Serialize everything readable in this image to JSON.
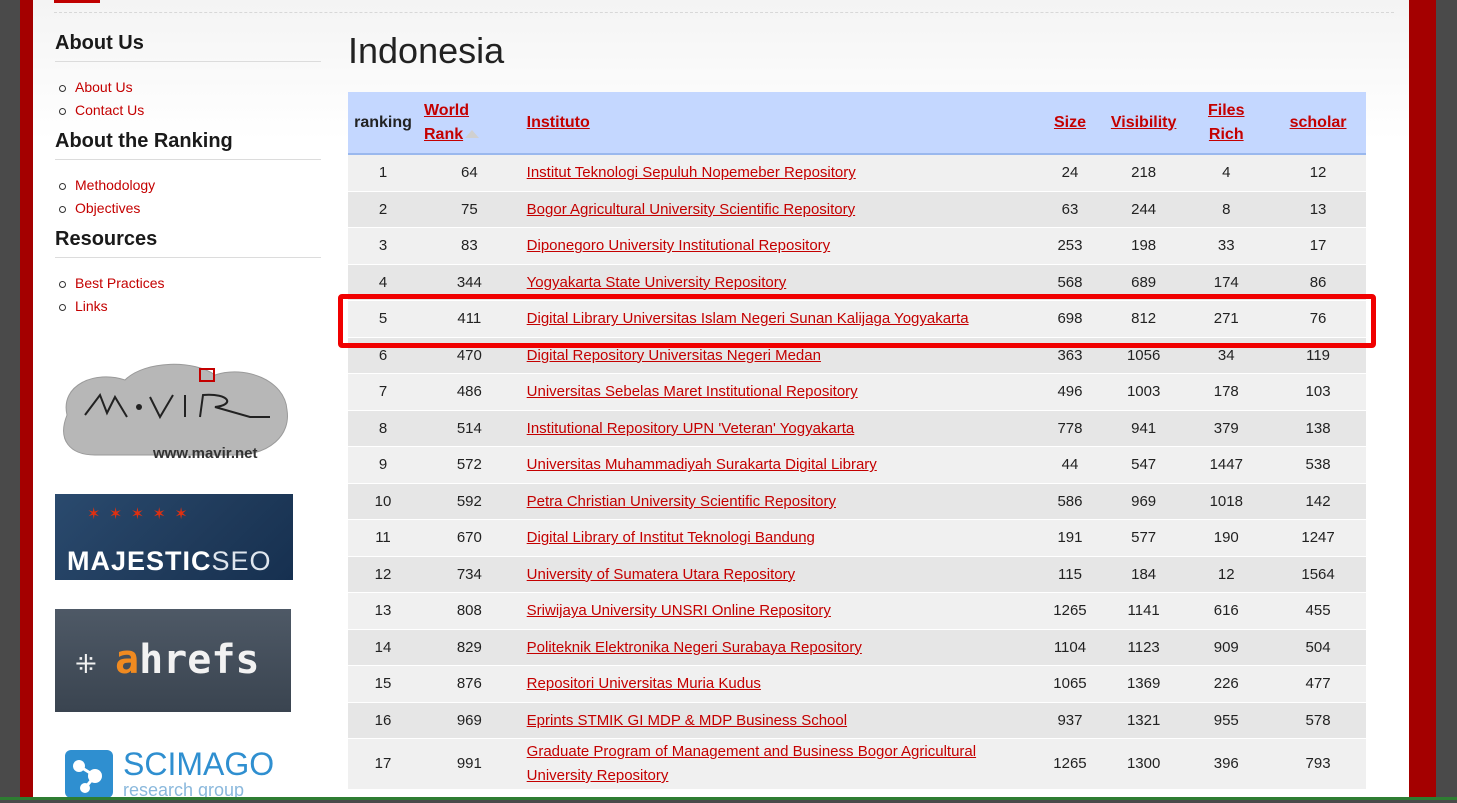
{
  "sidebar": {
    "sections": [
      {
        "heading": "About Us",
        "items": [
          "About Us",
          "Contact Us"
        ]
      },
      {
        "heading": "About the Ranking",
        "items": [
          "Methodology",
          "Objectives"
        ]
      },
      {
        "heading": "Resources",
        "items": [
          "Best Practices",
          "Links"
        ]
      }
    ],
    "logos": {
      "mavir_url": "www.mavir.net",
      "majestic_main": "MAJESTIC",
      "majestic_seo": "SEO",
      "ahrefs_a": "a",
      "ahrefs_rest": "hrefs",
      "scimago_name": "SCIMAGO",
      "scimago_sub": "research group"
    }
  },
  "main": {
    "title": "Indonesia",
    "headers": {
      "ranking": "ranking",
      "world_rank_1": "World",
      "world_rank_2": "Rank",
      "instituto": "Instituto",
      "size": "Size",
      "visibility": "Visibility",
      "files_rich_1": "Files",
      "files_rich_2": "Rich",
      "scholar": "scholar"
    },
    "rows": [
      [
        "1",
        "64",
        "Institut Teknologi Sepuluh Nopemeber Repository",
        "24",
        "218",
        "4",
        "12"
      ],
      [
        "2",
        "75",
        "Bogor Agricultural University Scientific Repository",
        "63",
        "244",
        "8",
        "13"
      ],
      [
        "3",
        "83",
        "Diponegoro University Institutional Repository",
        "253",
        "198",
        "33",
        "17"
      ],
      [
        "4",
        "344",
        "Yogyakarta State University Repository",
        "568",
        "689",
        "174",
        "86"
      ],
      [
        "5",
        "411",
        "Digital Library Universitas Islam Negeri Sunan Kalijaga Yogyakarta",
        "698",
        "812",
        "271",
        "76"
      ],
      [
        "6",
        "470",
        "Digital Repository Universitas Negeri Medan",
        "363",
        "1056",
        "34",
        "119"
      ],
      [
        "7",
        "486",
        "Universitas Sebelas Maret Institutional Repository",
        "496",
        "1003",
        "178",
        "103"
      ],
      [
        "8",
        "514",
        "Institutional Repository UPN 'Veteran' Yogyakarta",
        "778",
        "941",
        "379",
        "138"
      ],
      [
        "9",
        "572",
        "Universitas Muhammadiyah Surakarta Digital Library",
        "44",
        "547",
        "1447",
        "538"
      ],
      [
        "10",
        "592",
        "Petra Christian University Scientific Repository",
        "586",
        "969",
        "1018",
        "142"
      ],
      [
        "11",
        "670",
        "Digital Library of Institut Teknologi Bandung",
        "191",
        "577",
        "190",
        "1247"
      ],
      [
        "12",
        "734",
        "University of Sumatera Utara Repository",
        "115",
        "184",
        "12",
        "1564"
      ],
      [
        "13",
        "808",
        "Sriwijaya University UNSRI Online Repository",
        "1265",
        "1141",
        "616",
        "455"
      ],
      [
        "14",
        "829",
        "Politeknik Elektronika Negeri Surabaya Repository",
        "1104",
        "1123",
        "909",
        "504"
      ],
      [
        "15",
        "876",
        "Repositori Universitas Muria Kudus",
        "1065",
        "1369",
        "226",
        "477"
      ],
      [
        "16",
        "969",
        "Eprints STMIK GI MDP & MDP Business School",
        "937",
        "1321",
        "955",
        "578"
      ],
      [
        "17",
        "991",
        "Graduate Program of Management and Business Bogor Agricultural University Repository",
        "1265",
        "1300",
        "396",
        "793"
      ]
    ]
  },
  "colors": {
    "frame": "#a40000",
    "link": "#c40000",
    "header_bg": "#c4d7ff",
    "highlight": "#f00000"
  }
}
